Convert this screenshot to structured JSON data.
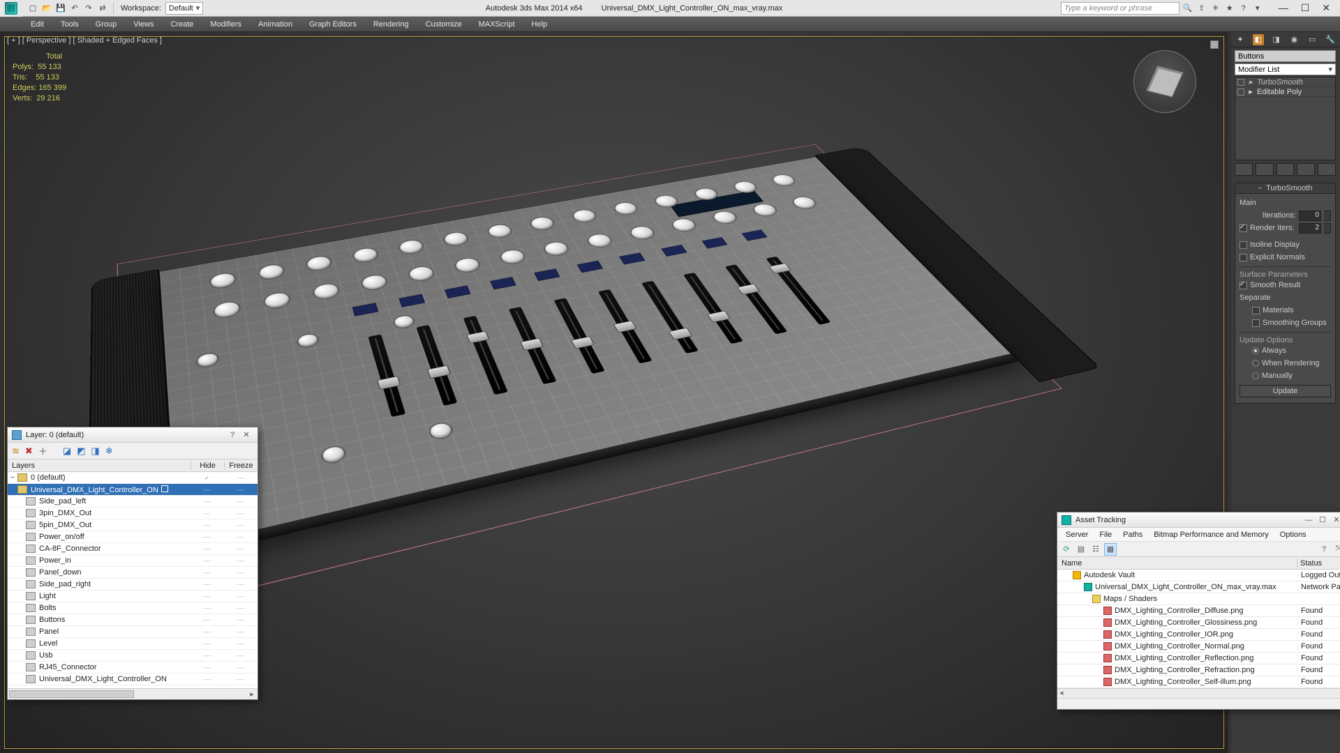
{
  "app": {
    "title": "Autodesk 3ds Max  2014 x64",
    "filename": "Universal_DMX_Light_Controller_ON_max_vray.max",
    "workspace_label": "Workspace:",
    "workspace_value": "Default",
    "search_placeholder": "Type a keyword or phrase"
  },
  "menus": [
    "Edit",
    "Tools",
    "Group",
    "Views",
    "Create",
    "Modifiers",
    "Animation",
    "Graph Editors",
    "Rendering",
    "Customize",
    "MAXScript",
    "Help"
  ],
  "viewport": {
    "label": "[ + ] [ Perspective ] [ Shaded + Edged Faces ]",
    "stats": {
      "total_label": "Total",
      "polys_label": "Polys:",
      "polys": "55 133",
      "tris_label": "Tris:",
      "tris": "55 133",
      "edges_label": "Edges:",
      "edges": "165 399",
      "verts_label": "Verts:",
      "verts": "29 216"
    }
  },
  "command_panel": {
    "object_name": "Buttons",
    "modifier_list_label": "Modifier List",
    "stack": [
      {
        "name": "TurboSmooth",
        "italic": true
      },
      {
        "name": "Editable Poly",
        "italic": false
      }
    ],
    "rollout_title": "TurboSmooth",
    "main_label": "Main",
    "iterations_label": "Iterations:",
    "iterations_value": "0",
    "render_iters_label": "Render Iters:",
    "render_iters_value": "2",
    "isoline_label": "Isoline Display",
    "explicit_label": "Explicit Normals",
    "surface_params_label": "Surface Parameters",
    "smooth_result_label": "Smooth Result",
    "separate_label": "Separate",
    "materials_label": "Materials",
    "smoothing_groups_label": "Smoothing Groups",
    "update_options_label": "Update Options",
    "always_label": "Always",
    "when_rendering_label": "When Rendering",
    "manually_label": "Manually",
    "update_button": "Update"
  },
  "layer_dialog": {
    "title": "Layer: 0 (default)",
    "col_layers": "Layers",
    "col_hide": "Hide",
    "col_freeze": "Freeze",
    "rows": [
      {
        "depth": 0,
        "expand": "−",
        "type": "layer",
        "name": "0 (default)",
        "hide": "✓",
        "freeze": "---"
      },
      {
        "depth": 1,
        "expand": "−",
        "type": "layer",
        "name": "Universal_DMX_Light_Controller_ON",
        "hide": "---",
        "freeze": "---",
        "selected": true
      },
      {
        "depth": 2,
        "expand": "",
        "type": "box",
        "name": "Side_pad_left",
        "hide": "---",
        "freeze": "---"
      },
      {
        "depth": 2,
        "expand": "",
        "type": "box",
        "name": "3pin_DMX_Out",
        "hide": "---",
        "freeze": "---"
      },
      {
        "depth": 2,
        "expand": "",
        "type": "box",
        "name": "5pin_DMX_Out",
        "hide": "---",
        "freeze": "---"
      },
      {
        "depth": 2,
        "expand": "",
        "type": "box",
        "name": "Power_on/off",
        "hide": "---",
        "freeze": "---"
      },
      {
        "depth": 2,
        "expand": "",
        "type": "box",
        "name": "CA-8F_Connector",
        "hide": "---",
        "freeze": "---"
      },
      {
        "depth": 2,
        "expand": "",
        "type": "box",
        "name": "Power_in",
        "hide": "---",
        "freeze": "---"
      },
      {
        "depth": 2,
        "expand": "",
        "type": "box",
        "name": "Panel_down",
        "hide": "---",
        "freeze": "---"
      },
      {
        "depth": 2,
        "expand": "",
        "type": "box",
        "name": "Side_pad_right",
        "hide": "---",
        "freeze": "---"
      },
      {
        "depth": 2,
        "expand": "",
        "type": "box",
        "name": "Light",
        "hide": "---",
        "freeze": "---"
      },
      {
        "depth": 2,
        "expand": "",
        "type": "box",
        "name": "Bolts",
        "hide": "---",
        "freeze": "---"
      },
      {
        "depth": 2,
        "expand": "",
        "type": "box",
        "name": "Buttons",
        "hide": "---",
        "freeze": "---"
      },
      {
        "depth": 2,
        "expand": "",
        "type": "box",
        "name": "Panel",
        "hide": "---",
        "freeze": "---"
      },
      {
        "depth": 2,
        "expand": "",
        "type": "box",
        "name": "Level",
        "hide": "---",
        "freeze": "---"
      },
      {
        "depth": 2,
        "expand": "",
        "type": "box",
        "name": "Usb",
        "hide": "---",
        "freeze": "---"
      },
      {
        "depth": 2,
        "expand": "",
        "type": "box",
        "name": "RJ45_Connector",
        "hide": "---",
        "freeze": "---"
      },
      {
        "depth": 2,
        "expand": "",
        "type": "box",
        "name": "Universal_DMX_Light_Controller_ON",
        "hide": "---",
        "freeze": "---"
      }
    ]
  },
  "asset_dialog": {
    "title": "Asset Tracking",
    "menus": [
      "Server",
      "File",
      "Paths",
      "Bitmap Performance and Memory",
      "Options"
    ],
    "col_name": "Name",
    "col_status": "Status",
    "rows": [
      {
        "indent": 18,
        "icon": "ai-vault",
        "name": "Autodesk Vault",
        "status": "Logged Out"
      },
      {
        "indent": 34,
        "icon": "ai-max",
        "name": "Universal_DMX_Light_Controller_ON_max_vray.max",
        "status": "Network Pa"
      },
      {
        "indent": 46,
        "icon": "ai-folder",
        "name": "Maps / Shaders",
        "status": ""
      },
      {
        "indent": 62,
        "icon": "ai-img",
        "name": "DMX_Lighting_Controller_Diffuse.png",
        "status": "Found"
      },
      {
        "indent": 62,
        "icon": "ai-img",
        "name": "DMX_Lighting_Controller_Glossiness.png",
        "status": "Found"
      },
      {
        "indent": 62,
        "icon": "ai-img",
        "name": "DMX_Lighting_Controller_IOR.png",
        "status": "Found"
      },
      {
        "indent": 62,
        "icon": "ai-img",
        "name": "DMX_Lighting_Controller_Normal.png",
        "status": "Found"
      },
      {
        "indent": 62,
        "icon": "ai-img",
        "name": "DMX_Lighting_Controller_Reflection.png",
        "status": "Found"
      },
      {
        "indent": 62,
        "icon": "ai-img",
        "name": "DMX_Lighting_Controller_Refraction.png",
        "status": "Found"
      },
      {
        "indent": 62,
        "icon": "ai-img",
        "name": "DMX_Lighting_Controller_Self-illum.png",
        "status": "Found"
      }
    ]
  }
}
